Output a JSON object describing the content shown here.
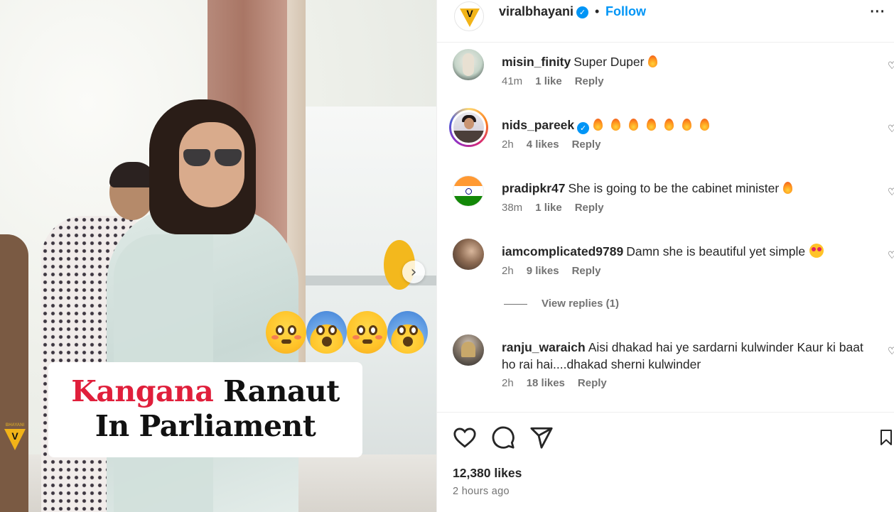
{
  "media": {
    "caption_red": "Kangana",
    "caption_black": "Ranaut",
    "caption_line2": "In Parliament",
    "watermark": "BHAYANI",
    "next_icon": "chevron-right-icon",
    "emojis": [
      "flushed-face",
      "face-screaming-in-fear",
      "flushed-face",
      "face-screaming-in-fear"
    ]
  },
  "header": {
    "username": "viralbhayani",
    "verified": "✓",
    "separator": "•",
    "follow_label": "Follow",
    "more_label": "···"
  },
  "comments": [
    {
      "username": "misin_finity",
      "text": "Super Duper",
      "time": "41m",
      "likes": "1 like",
      "reply": "Reply",
      "emojis": [
        "fire"
      ]
    },
    {
      "username": "nids_pareek",
      "verified": "✓",
      "text": "",
      "time": "2h",
      "likes": "4 likes",
      "reply": "Reply",
      "emojis": [
        "fire",
        "fire",
        "fire",
        "fire",
        "fire",
        "fire",
        "fire"
      ]
    },
    {
      "username": "pradipkr47",
      "text": "She is going to be the cabinet minister",
      "time": "38m",
      "likes": "1 like",
      "reply": "Reply",
      "emojis": [
        "fire"
      ]
    },
    {
      "username": "iamcomplicated9789",
      "text": "Damn she is beautiful yet simple",
      "time": "2h",
      "likes": "9 likes",
      "reply": "Reply",
      "emojis": [
        "smiling-face-with-heart-eyes"
      ]
    },
    {
      "username": "ranju_waraich",
      "text": "Aisi dhakad hai ye sardarni kulwinder Kaur ki baat ho rai hai....dhakad sherni kulwinder",
      "time": "2h",
      "likes": "18 likes",
      "reply": "Reply",
      "emojis": []
    }
  ],
  "view_replies": "View replies (1)",
  "footer": {
    "likes": "12,380 likes",
    "time": "2 hours ago"
  },
  "colors": {
    "accent": "#0095f6",
    "caption_red": "#e01f3b",
    "brand_yellow": "#f2b418"
  }
}
